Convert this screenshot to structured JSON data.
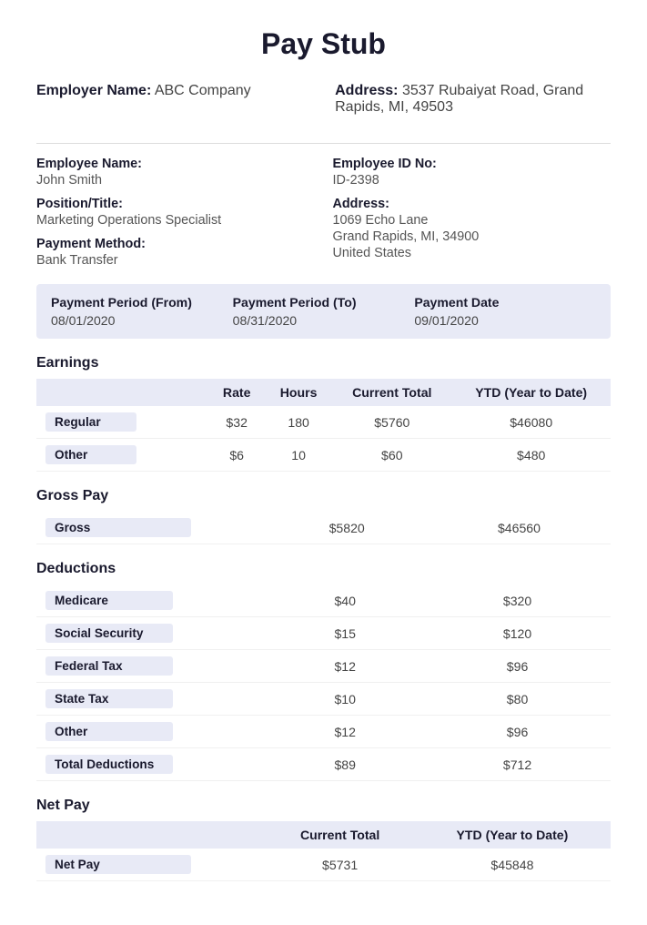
{
  "title": "Pay Stub",
  "employer": {
    "label": "Employer Name:",
    "name": "ABC Company",
    "address_label": "Address:",
    "address": "3537 Rubaiyat Road, Grand Rapids, MI, 49503"
  },
  "employee": {
    "name_label": "Employee Name:",
    "name": "John Smith",
    "id_label": "Employee ID No:",
    "id": "ID-2398",
    "position_label": "Position/Title:",
    "position": "Marketing Operations Specialist",
    "address_label": "Address:",
    "address_line1": "1069 Echo Lane",
    "address_line2": "Grand Rapids, MI, 34900",
    "address_line3": "United States",
    "payment_method_label": "Payment Method:",
    "payment_method": "Bank Transfer"
  },
  "payment_period": {
    "from_label": "Payment Period (From)",
    "from_value": "08/01/2020",
    "to_label": "Payment Period (To)",
    "to_value": "08/31/2020",
    "date_label": "Payment Date",
    "date_value": "09/01/2020"
  },
  "earnings": {
    "section_title": "Earnings",
    "col_rate": "Rate",
    "col_hours": "Hours",
    "col_current": "Current Total",
    "col_ytd": "YTD (Year to Date)",
    "rows": [
      {
        "label": "Regular",
        "rate": "$32",
        "hours": "180",
        "current": "$5760",
        "ytd": "$46080"
      },
      {
        "label": "Other",
        "rate": "$6",
        "hours": "10",
        "current": "$60",
        "ytd": "$480"
      }
    ]
  },
  "gross_pay": {
    "section_title": "Gross Pay",
    "label": "Gross",
    "current": "$5820",
    "ytd": "$46560"
  },
  "deductions": {
    "section_title": "Deductions",
    "rows": [
      {
        "label": "Medicare",
        "current": "$40",
        "ytd": "$320"
      },
      {
        "label": "Social Security",
        "current": "$15",
        "ytd": "$120"
      },
      {
        "label": "Federal Tax",
        "current": "$12",
        "ytd": "$96"
      },
      {
        "label": "State Tax",
        "current": "$10",
        "ytd": "$80"
      },
      {
        "label": "Other",
        "current": "$12",
        "ytd": "$96"
      },
      {
        "label": "Total Deductions",
        "current": "$89",
        "ytd": "$712"
      }
    ]
  },
  "net_pay": {
    "section_title": "Net Pay",
    "col_current": "Current Total",
    "col_ytd": "YTD (Year to Date)",
    "label": "Net Pay",
    "current": "$5731",
    "ytd": "$45848"
  }
}
